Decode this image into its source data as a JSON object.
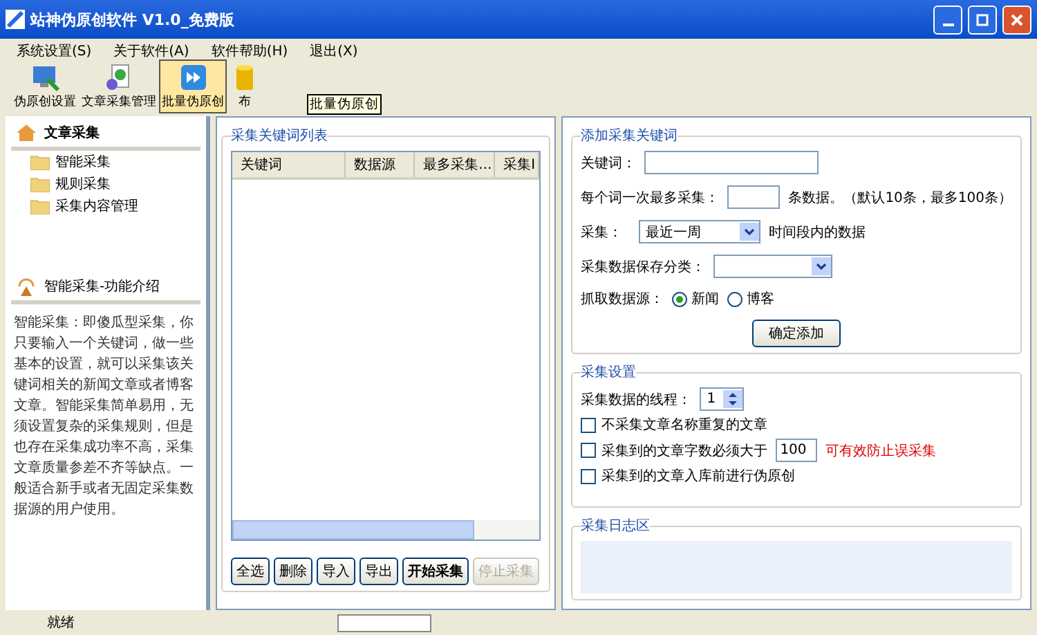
{
  "window": {
    "title": "站神伪原创软件 V1.0_免费版"
  },
  "menu": [
    "系统设置(S)",
    "关于软件(A)",
    "软件帮助(H)",
    "退出(X)"
  ],
  "toolbar": [
    {
      "label": "伪原创设置",
      "kind": "monitor",
      "selected": false
    },
    {
      "label": "文章采集管理",
      "kind": "doc",
      "selected": false
    },
    {
      "label": "批量伪原创",
      "kind": "forward",
      "selected": true
    },
    {
      "label": "布",
      "kind": "cylinder",
      "selected": false
    }
  ],
  "tooltip": "批量伪原创",
  "sidebar": {
    "title": "文章采集",
    "items": [
      "智能采集",
      "规则采集",
      "采集内容管理"
    ],
    "intro_title": "智能采集-功能介绍",
    "intro": "智能采集：即傻瓜型采集，你只要输入一个关键词，做一些基本的设置，就可以采集该关键词相关的新闻文章或者博客文章。智能采集简单易用，无须设置复杂的采集规则，但是也存在采集成功率不高，采集文章质量参差不齐等缺点。一般适合新手或者无固定采集数据源的用户使用。"
  },
  "keyword_list": {
    "title": "采集关键词列表",
    "columns": [
      "关键词",
      "数据源",
      "最多采集...",
      "采集I"
    ],
    "buttons": [
      {
        "label": "全选",
        "disabled": false
      },
      {
        "label": "删除",
        "disabled": false
      },
      {
        "label": "导入",
        "disabled": false
      },
      {
        "label": "导出",
        "disabled": false
      },
      {
        "label": "开始采集",
        "disabled": false
      },
      {
        "label": "停止采集",
        "disabled": true
      }
    ]
  },
  "add_keyword": {
    "title": "添加采集关键词",
    "keyword_label": "关键词：",
    "max_label": "每个词一次最多采集：",
    "max_hint": "条数据。（默认10条，最多100条）",
    "range_label": "采集：",
    "range_value": "最近一周",
    "range_hint": "时间段内的数据",
    "category_label": "采集数据保存分类：",
    "source_label": "抓取数据源：",
    "sources": [
      {
        "label": "新闻",
        "selected": true
      },
      {
        "label": "博客",
        "selected": false
      }
    ],
    "submit": "确定添加"
  },
  "settings": {
    "title": "采集设置",
    "threads_label": "采集数据的线程：",
    "threads_value": "1",
    "options": [
      {
        "label": "不采集文章名称重复的文章",
        "checked": false
      },
      {
        "label": "采集到的文章字数必须大于",
        "checked": false,
        "value": "100",
        "note": "可有效防止误采集"
      },
      {
        "label": "采集到的文章入库前进行伪原创",
        "checked": false
      }
    ]
  },
  "log": {
    "title": "采集日志区"
  },
  "status_bar": {
    "text": "就绪"
  }
}
